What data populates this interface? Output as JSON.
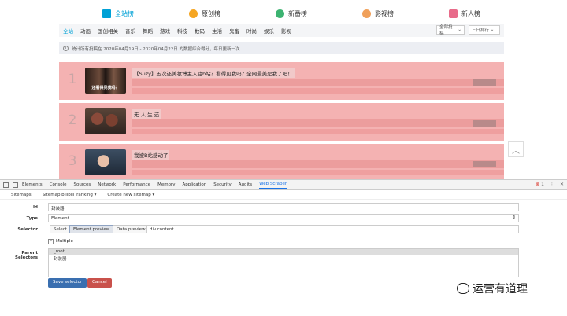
{
  "rank_tabs": [
    {
      "label": "全站榜",
      "icon": "bar-chart-icon",
      "color": "#00a1d6",
      "active": true
    },
    {
      "label": "原创榜",
      "icon": "crown-icon",
      "color": "#f5a623",
      "active": false
    },
    {
      "label": "新番榜",
      "icon": "tv-icon",
      "color": "#3cb371",
      "active": false
    },
    {
      "label": "影视榜",
      "icon": "film-icon",
      "color": "#f0a05a",
      "active": false
    },
    {
      "label": "新人榜",
      "icon": "newcomer-icon",
      "color": "#e86b8a",
      "active": false
    }
  ],
  "categories": [
    "全站",
    "动画",
    "国创相关",
    "音乐",
    "舞蹈",
    "游戏",
    "科技",
    "数码",
    "生活",
    "鬼畜",
    "时尚",
    "娱乐",
    "影视"
  ],
  "filters": {
    "submission": "全部投稿",
    "period": "三日排行"
  },
  "notice": "统计所有投稿在 2020年04月19日 - 2020年04月22日 的数据综合得分，每日更新一次",
  "ranking": [
    {
      "rank": "1",
      "title": "【Suzy】五次还美妆博主入驻b站？看得见我吗？全网最美是我了吧！",
      "thumb_caption": "还看得见我吗？"
    },
    {
      "rank": "2",
      "title": "无 人 生 还"
    },
    {
      "rank": "3",
      "title": "我被B站感动了"
    }
  ],
  "devtools": {
    "tabs": [
      "Elements",
      "Console",
      "Sources",
      "Network",
      "Performance",
      "Memory",
      "Application",
      "Security",
      "Audits",
      "Web Scraper"
    ],
    "active_tab": "Web Scraper",
    "error_count": "1",
    "ws_tabs": [
      "Sitemaps",
      "Sitemap bilibili_ranking ▾",
      "Create new sitemap ▾"
    ],
    "form": {
      "id_label": "Id",
      "id_value": "封装器",
      "type_label": "Type",
      "type_value": "Element",
      "selector_label": "Selector",
      "select_btn": "Select",
      "element_preview_btn": "Element preview",
      "data_preview_btn": "Data preview",
      "selector_value": "div.content",
      "multiple_label": "Multiple",
      "parent_label": "Parent Selectors",
      "parent_options": [
        "_root",
        "封装器"
      ],
      "save_btn": "Save selector",
      "cancel_btn": "Cancel"
    }
  },
  "watermark": "运营有道理"
}
